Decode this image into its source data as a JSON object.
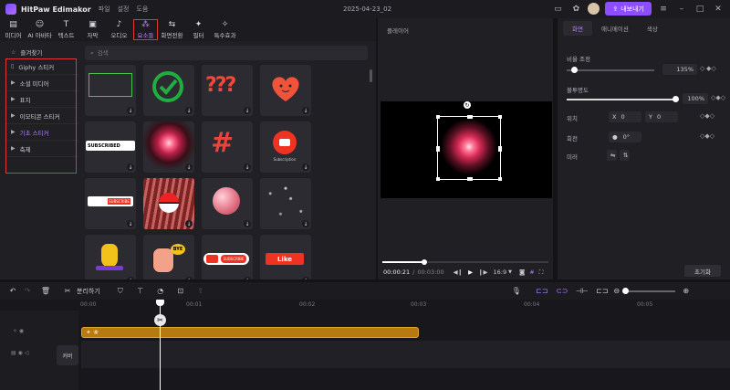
{
  "app": {
    "name": "HitPaw Edimakor",
    "menu": [
      "파일",
      "설정",
      "도움"
    ],
    "doc_title": "2025-04-23_02",
    "export_label": "내보내기"
  },
  "toolbar": [
    {
      "label": "미디어",
      "icon": "folder-icon"
    },
    {
      "label": "AI 아바타",
      "icon": "ai-avatar-icon"
    },
    {
      "label": "텍스트",
      "icon": "text-icon"
    },
    {
      "label": "자막",
      "icon": "subtitle-icon"
    },
    {
      "label": "오디오",
      "icon": "music-icon"
    },
    {
      "label": "요소들",
      "icon": "elements-icon",
      "active": true
    },
    {
      "label": "화면전환",
      "icon": "transition-icon"
    },
    {
      "label": "필터",
      "icon": "filter-icon"
    },
    {
      "label": "특수효과",
      "icon": "effects-icon"
    }
  ],
  "categories": {
    "favorites": "즐겨찾기",
    "items": [
      "Giphy 스티커",
      "소셜 미디어",
      "표지",
      "이모티콘 스티커",
      "기초 스티커",
      "축제"
    ],
    "selected_index": 4
  },
  "search": {
    "placeholder": "검색"
  },
  "stickers": [
    {
      "name": "green-rectangle-sticker"
    },
    {
      "name": "green-checkmark-sticker"
    },
    {
      "name": "question-marks-sticker"
    },
    {
      "name": "heart-face-sticker"
    },
    {
      "name": "subscribed-sticker",
      "text": "SUBSCRIBED"
    },
    {
      "name": "pink-glow-sticker"
    },
    {
      "name": "hash-sticker"
    },
    {
      "name": "youtube-subscribe-sticker",
      "text": "Subscription"
    },
    {
      "name": "subscribe-button-sticker",
      "text": "SUBSCRIBE"
    },
    {
      "name": "pokeball-sticker"
    },
    {
      "name": "pink-ball-sticker"
    },
    {
      "name": "sparkles-sticker"
    },
    {
      "name": "banana-sticker"
    },
    {
      "name": "bye-hand-sticker",
      "text": "BYE"
    },
    {
      "name": "youtube-subscribe-bar-sticker",
      "text": "SUBSCRIBE"
    },
    {
      "name": "like-sticker",
      "text": "Like"
    }
  ],
  "player": {
    "title": "플레이어",
    "current": "00:00:21",
    "separator": "/",
    "total": "00:03:00",
    "ratio": "16:9",
    "progress": 0.25
  },
  "properties": {
    "tabs": [
      "화면",
      "애니메이션",
      "색상"
    ],
    "scale_label": "비율 조정",
    "scale_value": "135%",
    "scale_fraction": 0.08,
    "opacity_label": "불투명도",
    "opacity_value": "100%",
    "opacity_fraction": 1.0,
    "position_label": "위치",
    "x_label": "X",
    "x_value": "0",
    "y_label": "Y",
    "y_value": "0",
    "rotate_label": "회전",
    "rotate_value": "0°",
    "mirror_label": "미러",
    "reset_label": "초기화"
  },
  "timeline": {
    "split_label": "분리하기",
    "ruler": [
      "00:00",
      "00:01",
      "00:02",
      "00:03",
      "00:04",
      "00:05"
    ],
    "cover_label": "커버"
  },
  "colors": {
    "accent": "#8e4dff",
    "highlight": "#e0353b",
    "clip": "#b77a11"
  }
}
